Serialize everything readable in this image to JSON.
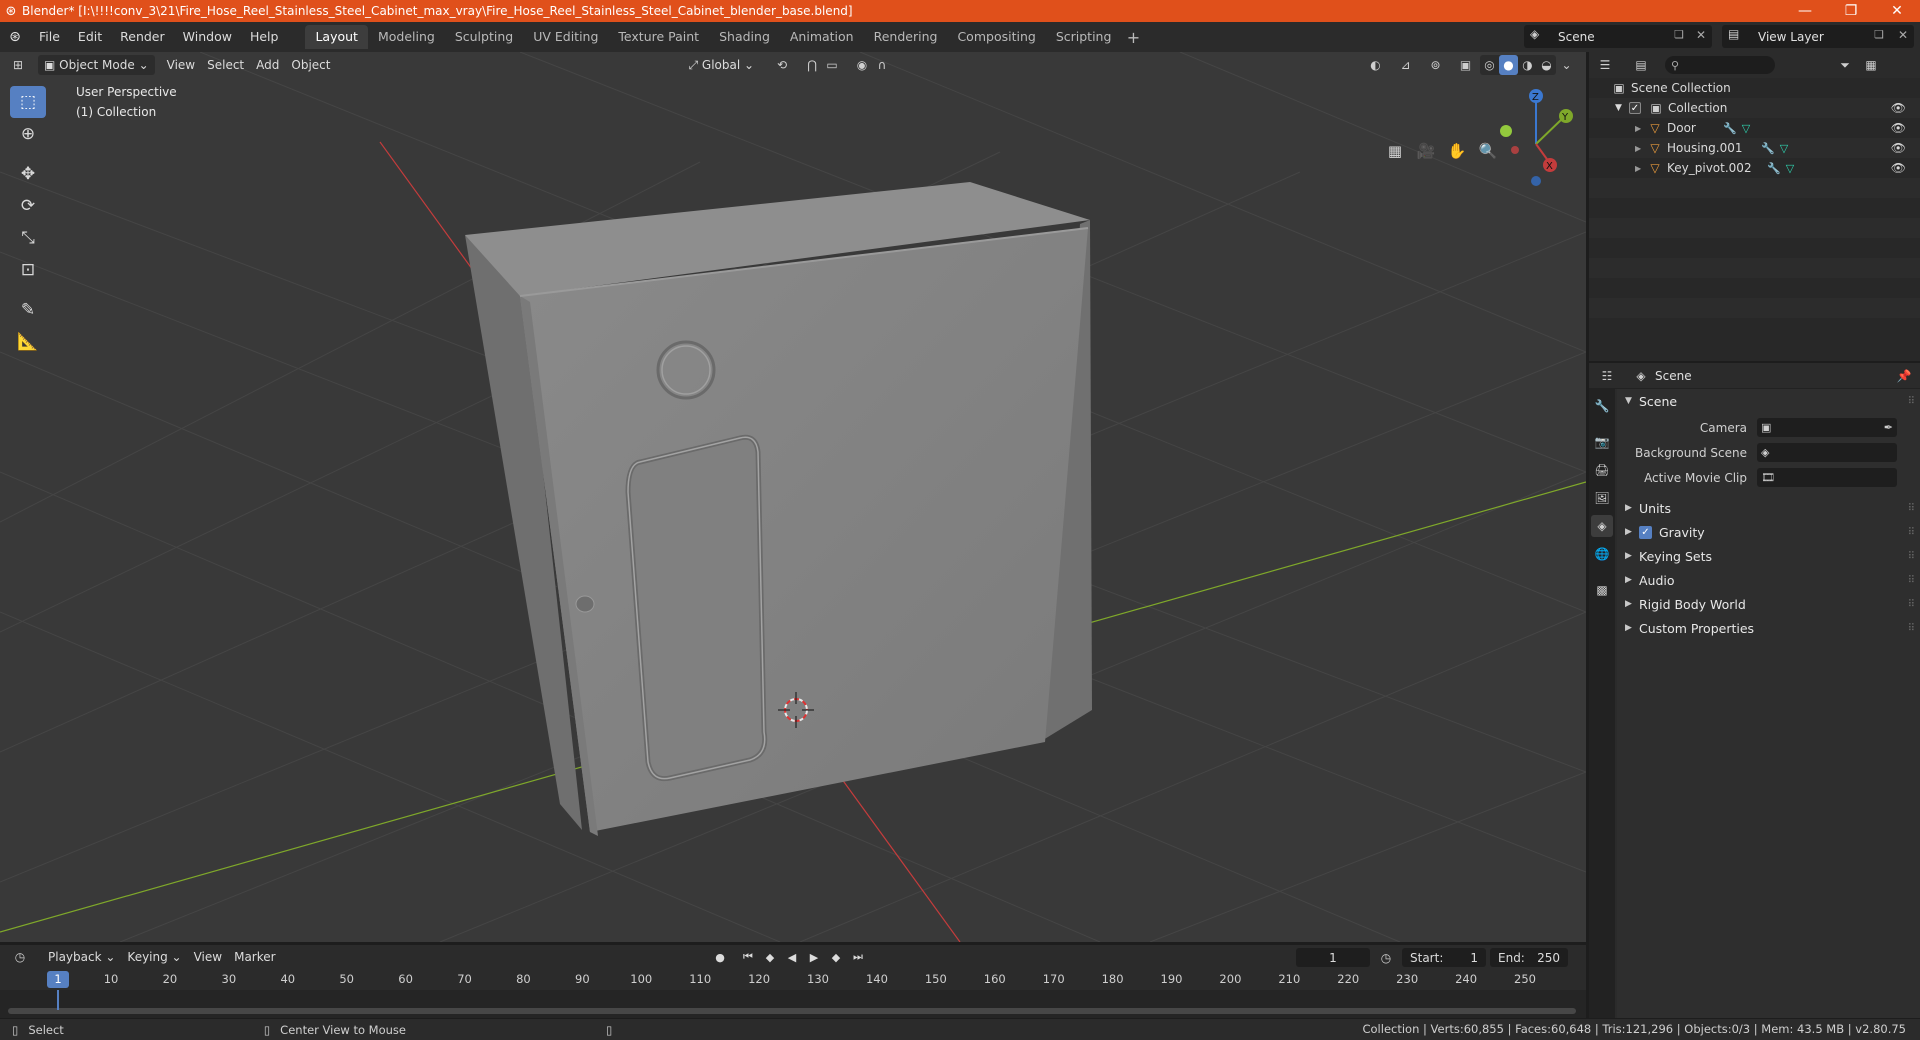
{
  "window": {
    "title": "Blender* [I:\\!!!!conv_3\\21\\Fire_Hose_Reel_Stainless_Steel_Cabinet_max_vray\\Fire_Hose_Reel_Stainless_Steel_Cabinet_blender_base.blend]",
    "minimize": "—",
    "maximize": "❐",
    "close": "✕"
  },
  "menu": [
    "File",
    "Edit",
    "Render",
    "Window",
    "Help"
  ],
  "workspaces": [
    "Layout",
    "Modeling",
    "Sculpting",
    "UV Editing",
    "Texture Paint",
    "Shading",
    "Animation",
    "Rendering",
    "Compositing",
    "Scripting"
  ],
  "active_workspace": "Layout",
  "scene_selector": "Scene",
  "view_layer_selector": "View Layer",
  "viewport": {
    "mode": "Object Mode",
    "menus": [
      "View",
      "Select",
      "Add",
      "Object"
    ],
    "orientation": "Global",
    "info_line1": "User Perspective",
    "info_line2": "(1) Collection",
    "gizmo_axes": {
      "x": "X",
      "y": "Y",
      "z": "Z"
    }
  },
  "outliner": {
    "root": "Scene Collection",
    "collection": "Collection",
    "objects": [
      "Door",
      "Housing.001",
      "Key_pivot.002"
    ]
  },
  "properties": {
    "header": "Scene",
    "panel": "Scene",
    "rows": [
      {
        "label": "Camera",
        "value": ""
      },
      {
        "label": "Background Scene",
        "value": ""
      },
      {
        "label": "Active Movie Clip",
        "value": ""
      }
    ],
    "subpanels": [
      "Units",
      "Gravity",
      "Keying Sets",
      "Audio",
      "Rigid Body World",
      "Custom Properties"
    ]
  },
  "timeline": {
    "menus": [
      "Playback",
      "Keying",
      "View",
      "Marker"
    ],
    "current_frame": "1",
    "start_label": "Start:",
    "start": "1",
    "end_label": "End:",
    "end": "250",
    "ticks": [
      "1",
      "10",
      "20",
      "30",
      "40",
      "50",
      "60",
      "70",
      "80",
      "90",
      "100",
      "110",
      "120",
      "130",
      "140",
      "150",
      "160",
      "170",
      "180",
      "190",
      "200",
      "210",
      "220",
      "230",
      "240",
      "250"
    ]
  },
  "status": {
    "left1": "Select",
    "left2": "Center View to Mouse",
    "right": "Collection | Verts:60,855 | Faces:60,648 | Tris:121,296 | Objects:0/3 | Mem: 43.5 MB | v2.80.75"
  },
  "colors": {
    "title_bar": "#e0501b",
    "accent": "#5680c2",
    "x_axis": "#c43c3c",
    "y_axis": "#7fa82a",
    "object_icon": "#e79a3c"
  }
}
